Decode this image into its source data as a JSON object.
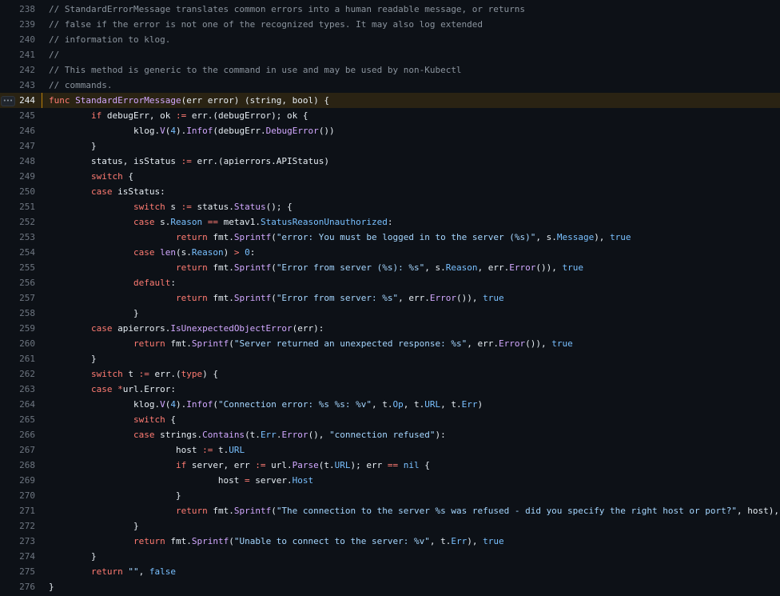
{
  "editor": {
    "highlighted_line": 244,
    "line_menu_icon": "kebab-horizontal-icon",
    "line_menu_glyph": "•••",
    "colors": {
      "background": "#0d1117",
      "text": "#e6edf3",
      "line_number": "#6e7681",
      "keyword": "#ff7b72",
      "comment": "#8b949e",
      "string": "#a5d6ff",
      "function": "#d2a8ff",
      "property": "#79c0ff",
      "highlight_bg": "#2a2313",
      "highlight_border": "#bb8009"
    },
    "lines": [
      {
        "num": 238,
        "tokens": [
          [
            "com",
            "// StandardErrorMessage translates common errors into a human readable message, or returns"
          ]
        ]
      },
      {
        "num": 239,
        "tokens": [
          [
            "com",
            "// false if the error is not one of the recognized types. It may also log extended"
          ]
        ]
      },
      {
        "num": 240,
        "tokens": [
          [
            "com",
            "// information to klog."
          ]
        ]
      },
      {
        "num": 241,
        "tokens": [
          [
            "com",
            "//"
          ]
        ]
      },
      {
        "num": 242,
        "tokens": [
          [
            "com",
            "// This method is generic to the command in use and may be used by non-Kubectl"
          ]
        ]
      },
      {
        "num": 243,
        "tokens": [
          [
            "com",
            "// commands."
          ]
        ]
      },
      {
        "num": 244,
        "tokens": [
          [
            "kw",
            "func"
          ],
          [
            "",
            " "
          ],
          [
            "fn",
            "StandardErrorMessage"
          ],
          [
            "",
            "(err error) (string, bool) {"
          ]
        ]
      },
      {
        "num": 245,
        "tokens": [
          [
            "",
            "\t"
          ],
          [
            "kw",
            "if"
          ],
          [
            "",
            " debugErr, ok "
          ],
          [
            "op",
            ":="
          ],
          [
            "",
            " err.(debugError); ok {"
          ]
        ]
      },
      {
        "num": 246,
        "tokens": [
          [
            "",
            "\t\tklog."
          ],
          [
            "fn",
            "V"
          ],
          [
            "",
            "("
          ],
          [
            "num",
            "4"
          ],
          [
            "",
            ")."
          ],
          [
            "fn",
            "Infof"
          ],
          [
            "",
            "(debugErr."
          ],
          [
            "fn",
            "DebugError"
          ],
          [
            "",
            "())"
          ]
        ]
      },
      {
        "num": 247,
        "tokens": [
          [
            "",
            "\t}"
          ]
        ]
      },
      {
        "num": 248,
        "tokens": [
          [
            "",
            "\tstatus, isStatus "
          ],
          [
            "op",
            ":="
          ],
          [
            "",
            " err.(apierrors.APIStatus)"
          ]
        ]
      },
      {
        "num": 249,
        "tokens": [
          [
            "",
            "\t"
          ],
          [
            "kw",
            "switch"
          ],
          [
            "",
            " {"
          ]
        ]
      },
      {
        "num": 250,
        "tokens": [
          [
            "",
            "\t"
          ],
          [
            "kw",
            "case"
          ],
          [
            "",
            " isStatus:"
          ]
        ]
      },
      {
        "num": 251,
        "tokens": [
          [
            "",
            "\t\t"
          ],
          [
            "kw",
            "switch"
          ],
          [
            "",
            " s "
          ],
          [
            "op",
            ":="
          ],
          [
            "",
            " status."
          ],
          [
            "fn",
            "Status"
          ],
          [
            "",
            "(); {"
          ]
        ]
      },
      {
        "num": 252,
        "tokens": [
          [
            "",
            "\t\t"
          ],
          [
            "kw",
            "case"
          ],
          [
            "",
            " s."
          ],
          [
            "prop",
            "Reason"
          ],
          [
            "",
            " "
          ],
          [
            "op",
            "=="
          ],
          [
            "",
            " metav1."
          ],
          [
            "prop",
            "StatusReasonUnauthorized"
          ],
          [
            "",
            ":"
          ]
        ]
      },
      {
        "num": 253,
        "tokens": [
          [
            "",
            "\t\t\t"
          ],
          [
            "kw",
            "return"
          ],
          [
            "",
            " fmt."
          ],
          [
            "fn",
            "Sprintf"
          ],
          [
            "",
            "("
          ],
          [
            "str",
            "\"error: You must be logged in to the server (%s)\""
          ],
          [
            "",
            ", s."
          ],
          [
            "prop",
            "Message"
          ],
          [
            "",
            "), "
          ],
          [
            "const",
            "true"
          ]
        ]
      },
      {
        "num": 254,
        "tokens": [
          [
            "",
            "\t\t"
          ],
          [
            "kw",
            "case"
          ],
          [
            "",
            " "
          ],
          [
            "fn",
            "len"
          ],
          [
            "",
            "(s."
          ],
          [
            "prop",
            "Reason"
          ],
          [
            "",
            ") "
          ],
          [
            "op",
            ">"
          ],
          [
            "",
            " "
          ],
          [
            "num",
            "0"
          ],
          [
            "",
            ":"
          ]
        ]
      },
      {
        "num": 255,
        "tokens": [
          [
            "",
            "\t\t\t"
          ],
          [
            "kw",
            "return"
          ],
          [
            "",
            " fmt."
          ],
          [
            "fn",
            "Sprintf"
          ],
          [
            "",
            "("
          ],
          [
            "str",
            "\"Error from server (%s): %s\""
          ],
          [
            "",
            ", s."
          ],
          [
            "prop",
            "Reason"
          ],
          [
            "",
            ", err."
          ],
          [
            "fn",
            "Error"
          ],
          [
            "",
            "()), "
          ],
          [
            "const",
            "true"
          ]
        ]
      },
      {
        "num": 256,
        "tokens": [
          [
            "",
            "\t\t"
          ],
          [
            "kw",
            "default"
          ],
          [
            "",
            ":"
          ]
        ]
      },
      {
        "num": 257,
        "tokens": [
          [
            "",
            "\t\t\t"
          ],
          [
            "kw",
            "return"
          ],
          [
            "",
            " fmt."
          ],
          [
            "fn",
            "Sprintf"
          ],
          [
            "",
            "("
          ],
          [
            "str",
            "\"Error from server: %s\""
          ],
          [
            "",
            ", err."
          ],
          [
            "fn",
            "Error"
          ],
          [
            "",
            "()), "
          ],
          [
            "const",
            "true"
          ]
        ]
      },
      {
        "num": 258,
        "tokens": [
          [
            "",
            "\t\t}"
          ]
        ]
      },
      {
        "num": 259,
        "tokens": [
          [
            "",
            "\t"
          ],
          [
            "kw",
            "case"
          ],
          [
            "",
            " apierrors."
          ],
          [
            "fn",
            "IsUnexpectedObjectError"
          ],
          [
            "",
            "(err):"
          ]
        ]
      },
      {
        "num": 260,
        "tokens": [
          [
            "",
            "\t\t"
          ],
          [
            "kw",
            "return"
          ],
          [
            "",
            " fmt."
          ],
          [
            "fn",
            "Sprintf"
          ],
          [
            "",
            "("
          ],
          [
            "str",
            "\"Server returned an unexpected response: %s\""
          ],
          [
            "",
            ", err."
          ],
          [
            "fn",
            "Error"
          ],
          [
            "",
            "()), "
          ],
          [
            "const",
            "true"
          ]
        ]
      },
      {
        "num": 261,
        "tokens": [
          [
            "",
            "\t}"
          ]
        ]
      },
      {
        "num": 262,
        "tokens": [
          [
            "",
            "\t"
          ],
          [
            "kw",
            "switch"
          ],
          [
            "",
            " t "
          ],
          [
            "op",
            ":="
          ],
          [
            "",
            " err.("
          ],
          [
            "kw",
            "type"
          ],
          [
            "",
            ") {"
          ]
        ]
      },
      {
        "num": 263,
        "tokens": [
          [
            "",
            "\t"
          ],
          [
            "kw",
            "case"
          ],
          [
            "",
            " "
          ],
          [
            "op",
            "*"
          ],
          [
            "",
            "url.Error:"
          ]
        ]
      },
      {
        "num": 264,
        "tokens": [
          [
            "",
            "\t\tklog."
          ],
          [
            "fn",
            "V"
          ],
          [
            "",
            "("
          ],
          [
            "num",
            "4"
          ],
          [
            "",
            ")."
          ],
          [
            "fn",
            "Infof"
          ],
          [
            "",
            "("
          ],
          [
            "str",
            "\"Connection error: %s %s: %v\""
          ],
          [
            "",
            ", t."
          ],
          [
            "prop",
            "Op"
          ],
          [
            "",
            ", t."
          ],
          [
            "prop",
            "URL"
          ],
          [
            "",
            ", t."
          ],
          [
            "prop",
            "Err"
          ],
          [
            "",
            ")"
          ]
        ]
      },
      {
        "num": 265,
        "tokens": [
          [
            "",
            "\t\t"
          ],
          [
            "kw",
            "switch"
          ],
          [
            "",
            " {"
          ]
        ]
      },
      {
        "num": 266,
        "tokens": [
          [
            "",
            "\t\t"
          ],
          [
            "kw",
            "case"
          ],
          [
            "",
            " strings."
          ],
          [
            "fn",
            "Contains"
          ],
          [
            "",
            "(t."
          ],
          [
            "prop",
            "Err"
          ],
          [
            "",
            "."
          ],
          [
            "fn",
            "Error"
          ],
          [
            "",
            "(), "
          ],
          [
            "str",
            "\"connection refused\""
          ],
          [
            "",
            "):"
          ]
        ]
      },
      {
        "num": 267,
        "tokens": [
          [
            "",
            "\t\t\thost "
          ],
          [
            "op",
            ":="
          ],
          [
            "",
            " t."
          ],
          [
            "prop",
            "URL"
          ]
        ]
      },
      {
        "num": 268,
        "tokens": [
          [
            "",
            "\t\t\t"
          ],
          [
            "kw",
            "if"
          ],
          [
            "",
            " server, err "
          ],
          [
            "op",
            ":="
          ],
          [
            "",
            " url."
          ],
          [
            "fn",
            "Parse"
          ],
          [
            "",
            "(t."
          ],
          [
            "prop",
            "URL"
          ],
          [
            "",
            "); err "
          ],
          [
            "op",
            "=="
          ],
          [
            "",
            " "
          ],
          [
            "const",
            "nil"
          ],
          [
            "",
            " {"
          ]
        ]
      },
      {
        "num": 269,
        "tokens": [
          [
            "",
            "\t\t\t\thost "
          ],
          [
            "op",
            "="
          ],
          [
            "",
            " server."
          ],
          [
            "prop",
            "Host"
          ]
        ]
      },
      {
        "num": 270,
        "tokens": [
          [
            "",
            "\t\t\t}"
          ]
        ]
      },
      {
        "num": 271,
        "tokens": [
          [
            "",
            "\t\t\t"
          ],
          [
            "kw",
            "return"
          ],
          [
            "",
            " fmt."
          ],
          [
            "fn",
            "Sprintf"
          ],
          [
            "",
            "("
          ],
          [
            "str",
            "\"The connection to the server %s was refused - did you specify the right host or port?\""
          ],
          [
            "",
            ", host), "
          ],
          [
            "const",
            "true"
          ]
        ]
      },
      {
        "num": 272,
        "tokens": [
          [
            "",
            "\t\t}"
          ]
        ]
      },
      {
        "num": 273,
        "tokens": [
          [
            "",
            "\t\t"
          ],
          [
            "kw",
            "return"
          ],
          [
            "",
            " fmt."
          ],
          [
            "fn",
            "Sprintf"
          ],
          [
            "",
            "("
          ],
          [
            "str",
            "\"Unable to connect to the server: %v\""
          ],
          [
            "",
            ", t."
          ],
          [
            "prop",
            "Err"
          ],
          [
            "",
            "), "
          ],
          [
            "const",
            "true"
          ]
        ]
      },
      {
        "num": 274,
        "tokens": [
          [
            "",
            "\t}"
          ]
        ]
      },
      {
        "num": 275,
        "tokens": [
          [
            "",
            "\t"
          ],
          [
            "kw",
            "return"
          ],
          [
            "",
            " "
          ],
          [
            "str",
            "\"\""
          ],
          [
            "",
            ", "
          ],
          [
            "const",
            "false"
          ]
        ]
      },
      {
        "num": 276,
        "tokens": [
          [
            "",
            "}"
          ]
        ]
      }
    ]
  }
}
